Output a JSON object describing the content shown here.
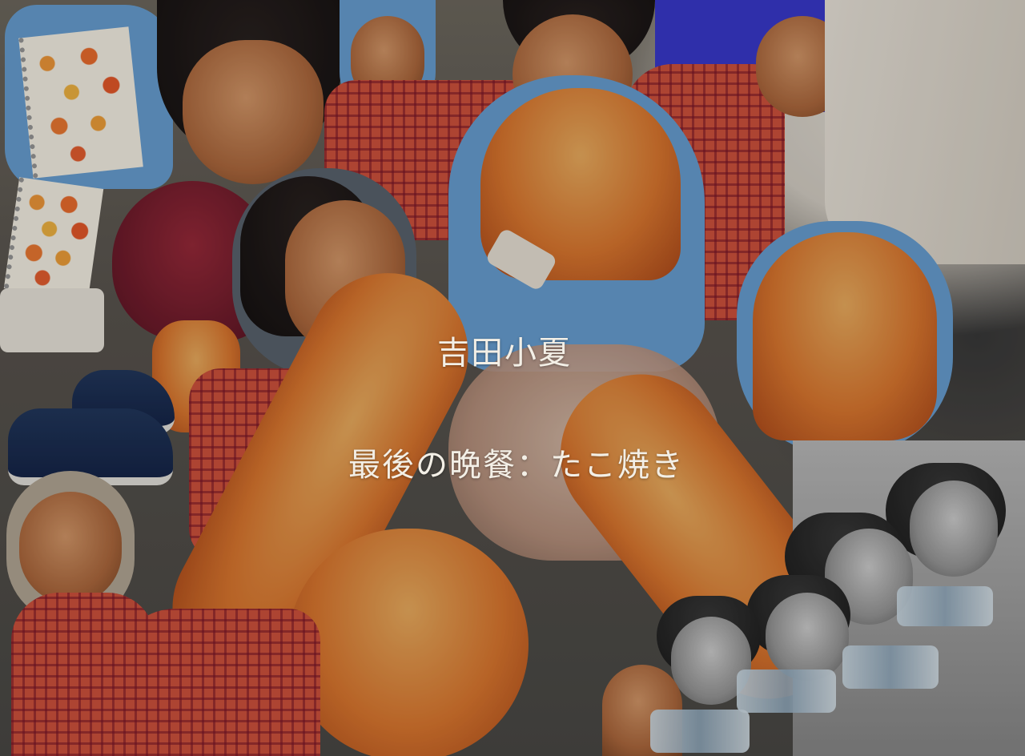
{
  "title": "吉田小夏",
  "subtitle": "最後の晩餐：たこ焼き"
}
